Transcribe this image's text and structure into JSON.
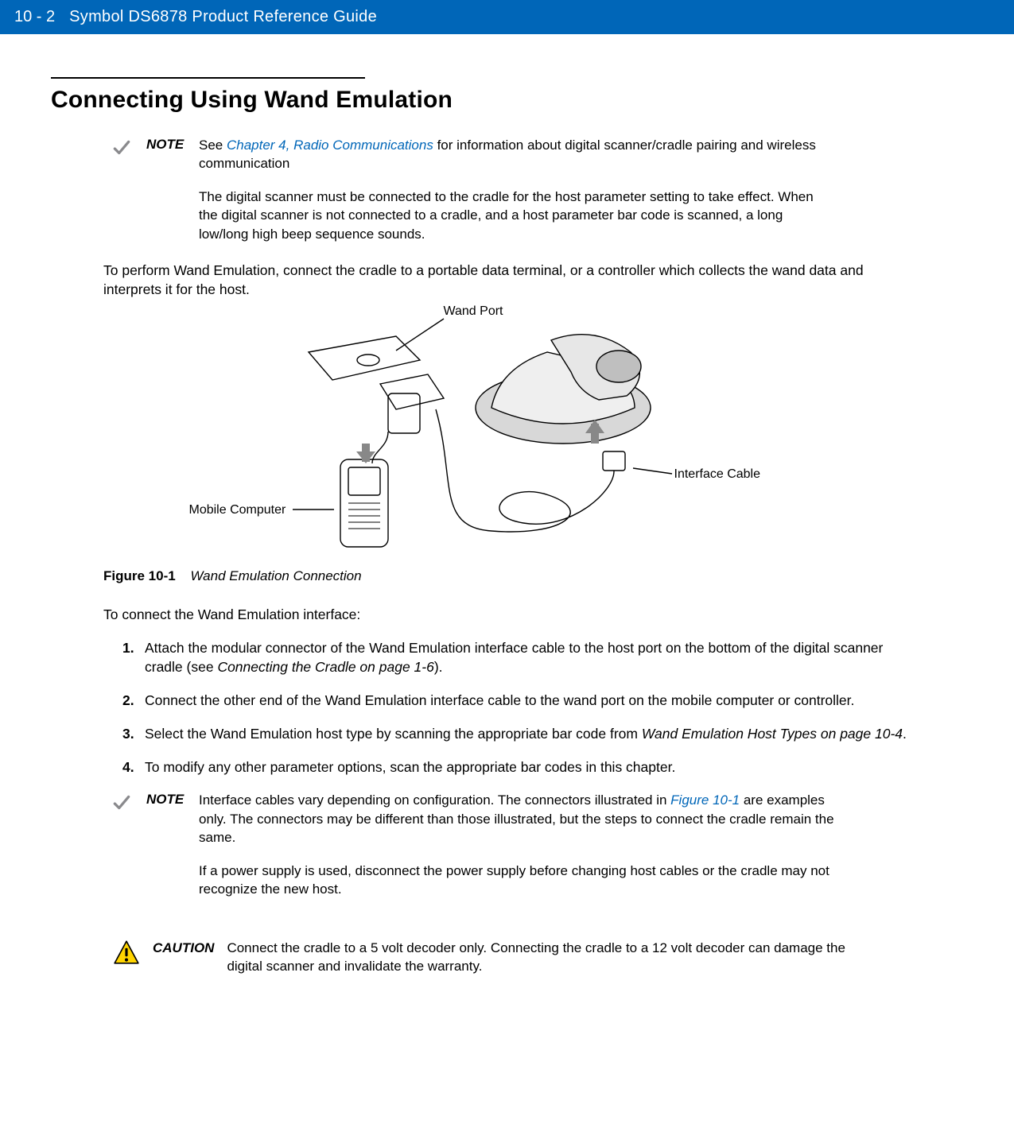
{
  "header": {
    "page_number": "10 - 2",
    "title": "Symbol DS6878 Product Reference Guide"
  },
  "section": {
    "heading": "Connecting Using Wand Emulation",
    "note1": {
      "label": "NOTE",
      "p1_prefix": "See ",
      "p1_link": "Chapter 4, Radio Communications",
      "p1_suffix": " for information about digital scanner/cradle pairing and wireless communication",
      "p2": "The digital scanner must be connected to the cradle for the host parameter setting to take effect. When the digital scanner is not connected to a cradle, and a host parameter bar code is scanned, a long low/long high beep sequence sounds."
    },
    "intro": "To perform Wand Emulation, connect the cradle to a portable data terminal, or a controller which collects the wand data and interprets it for the host.",
    "figure": {
      "wand_port": "Wand Port",
      "mobile_computer": "Mobile Computer",
      "interface_cable": "Interface Cable",
      "caption_num": "Figure 10-1",
      "caption_title": "Wand Emulation Connection"
    },
    "connect_intro": "To connect the Wand Emulation interface:",
    "steps": [
      {
        "n": "1.",
        "a": "Attach the modular connector of the Wand Emulation interface cable to the host port on the bottom of the digital scanner cradle (see ",
        "ref": "Connecting the Cradle on page 1-6",
        "b": ")."
      },
      {
        "n": "2.",
        "a": "Connect the other end of the Wand Emulation interface cable to the wand port on the mobile computer or controller.",
        "ref": "",
        "b": ""
      },
      {
        "n": "3.",
        "a": "Select the Wand Emulation host type by scanning the appropriate bar code from ",
        "ref": "Wand Emulation Host Types on page 10-4",
        "b": "."
      },
      {
        "n": "4.",
        "a": "To modify any other parameter options, scan the appropriate bar codes in this chapter.",
        "ref": "",
        "b": ""
      }
    ],
    "note2": {
      "label": "NOTE",
      "p1_prefix": "Interface cables vary depending on configuration. The connectors illustrated in ",
      "p1_link": "Figure 10-1",
      "p1_suffix": " are examples only. The connectors may be different than those illustrated, but the steps to connect the cradle remain the same.",
      "p2": "If a power supply is used, disconnect the power supply before changing host cables or the cradle may not recognize the new host."
    },
    "caution": {
      "label": "CAUTION",
      "text": "Connect the cradle to a 5 volt decoder only. Connecting the cradle to a 12 volt decoder can damage the digital scanner and invalidate the warranty."
    }
  }
}
